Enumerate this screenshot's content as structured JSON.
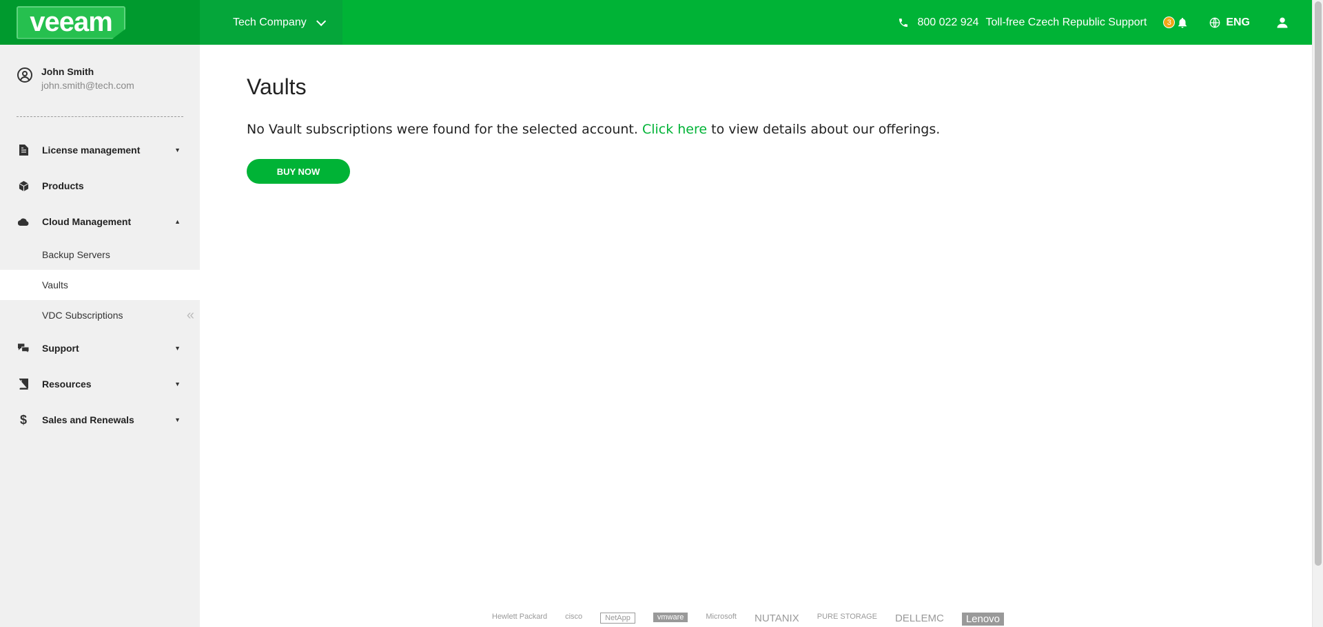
{
  "header": {
    "logo": "veeam",
    "company": "Tech Company",
    "phone": "800 022 924",
    "support_text": "Toll-free Czech Republic Support",
    "notification_count": "3",
    "language": "ENG",
    "colors": {
      "primary": "#00b336",
      "dark": "#009a2e",
      "badge": "#f2a516"
    }
  },
  "user": {
    "name": "John Smith",
    "email": "john.smith@tech.com"
  },
  "sidebar": {
    "items": [
      {
        "label": "License management",
        "icon": "document-icon",
        "expanded": false
      },
      {
        "label": "Products",
        "icon": "box-icon"
      },
      {
        "label": "Cloud Management",
        "icon": "cloud-icon",
        "expanded": true,
        "children": [
          {
            "label": "Backup Servers"
          },
          {
            "label": "Vaults",
            "active": true
          },
          {
            "label": "VDC Subscriptions"
          }
        ]
      },
      {
        "label": "Support",
        "icon": "chat-icon",
        "expanded": false
      },
      {
        "label": "Resources",
        "icon": "book-icon",
        "expanded": false
      },
      {
        "label": "Sales and Renewals",
        "icon": "dollar-icon",
        "expanded": false
      }
    ],
    "collapse_glyph": "«"
  },
  "main": {
    "title": "Vaults",
    "message_before": "No Vault subscriptions were found for the selected account. ",
    "message_link": "Click here",
    "message_after": " to view details about our offerings.",
    "buy_button": "BUY NOW"
  },
  "partners": [
    "Hewlett Packard",
    "cisco",
    "NetApp",
    "vmware",
    "Microsoft",
    "NUTANIX",
    "PURE STORAGE",
    "DELLEMC",
    "Lenovo"
  ]
}
